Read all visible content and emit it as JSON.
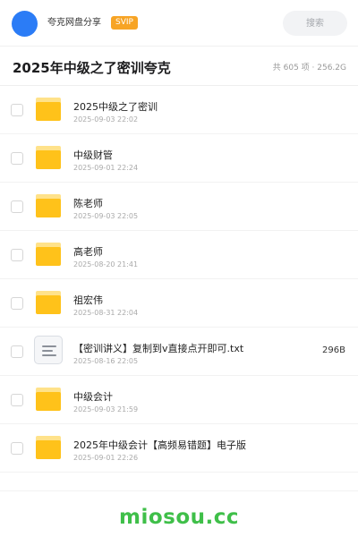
{
  "header": {
    "site_name": "夸克网盘分享",
    "badge": "SVIP",
    "search_placeholder": "搜索",
    "avatar_color": "#2b7cf6"
  },
  "share": {
    "title": "2025年中级之了密训夸克",
    "summary": "共 605 项 · 256.2G"
  },
  "files": [
    {
      "type": "folder",
      "name": "2025中级之了密训",
      "date": "2025-09-03 22:02",
      "size": ""
    },
    {
      "type": "folder",
      "name": "中级财管",
      "date": "2025-09-01 22:24",
      "size": ""
    },
    {
      "type": "folder",
      "name": "陈老师",
      "date": "2025-09-03 22:05",
      "size": ""
    },
    {
      "type": "folder",
      "name": "高老师",
      "date": "2025-08-20 21:41",
      "size": ""
    },
    {
      "type": "folder",
      "name": "祖宏伟",
      "date": "2025-08-31 22:04",
      "size": ""
    },
    {
      "type": "document",
      "name": "【密训讲义】复制到v直接点开即可.txt",
      "date": "2025-08-16 22:05",
      "size": "296B"
    },
    {
      "type": "folder",
      "name": "中级会计",
      "date": "2025-09-03 21:59",
      "size": ""
    },
    {
      "type": "folder",
      "name": "2025年中级会计【高频易错题】电子版",
      "date": "2025-09-01 22:26",
      "size": ""
    }
  ],
  "footer": {
    "watermark": "miosou.cc",
    "watermark_color": "#3fbf49"
  },
  "colors": {
    "folder_yellow": "#ffc21a",
    "badge_orange": "#f7a425"
  }
}
